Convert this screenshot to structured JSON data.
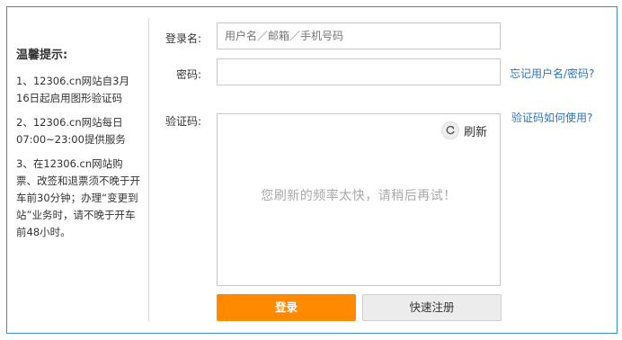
{
  "tips": {
    "title": "温馨提示:",
    "items": [
      "1、12306.cn网站自3月16日起启用图形验证码",
      "2、12306.cn网站每日07:00~23:00提供服务",
      "3、在12306.cn网站购票、改签和退票须不晚于开车前30分钟；办理“变更到站”业务时，请不晚于开车前48小时。"
    ]
  },
  "form": {
    "username_label": "登录名:",
    "username_placeholder": "用户名／邮箱／手机号码",
    "password_label": "密码:",
    "forgot_link": "忘记用户名/密码?",
    "captcha_label": "验证码:",
    "captcha_help_link": "验证码如何使用?",
    "refresh_label": "刷新",
    "captcha_message": "您刷新的频率太快，请稍后再试！",
    "login_button": "登录",
    "register_button": "快速注册"
  },
  "colors": {
    "accent": "#ff8a00",
    "link": "#2b74c4",
    "border": "#3b8bc4"
  },
  "icons": {
    "refresh": "refresh-icon"
  }
}
